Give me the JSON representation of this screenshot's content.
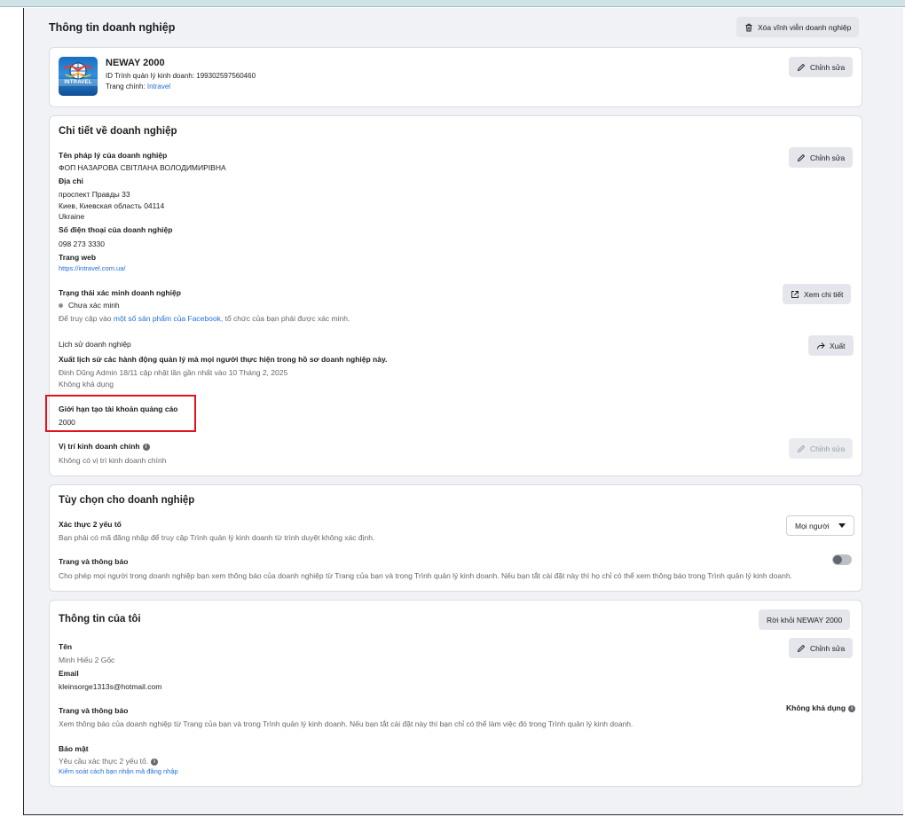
{
  "header": {
    "title": "Thông tin doanh nghiệp",
    "delete_label": "Xóa vĩnh viễn doanh nghiệp"
  },
  "business_card": {
    "logo_text": "INTRAVEL",
    "name": "NEWAY 2000",
    "id_line": "ID Trình quản lý kinh doanh: 199302597560460",
    "page_label": "Trang chính: ",
    "page_link": "Intravel",
    "edit_label": "Chỉnh sửa"
  },
  "details": {
    "title": "Chi tiết về doanh nghiệp",
    "edit_label": "Chỉnh sửa",
    "legal_name_label": "Tên pháp lý của doanh nghiệp",
    "legal_name_value": "ФОП НАЗАРОВА СВІТЛАНА ВОЛОДИМИРІВНА",
    "address_label": "Địa chỉ",
    "address_line1": "проспект Правды 33",
    "address_line2": "Киев, Киевская область 04114",
    "address_line3": "Ukraine",
    "phone_label": "Số điện thoại của doanh nghiệp",
    "phone_value": "098 273 3330",
    "website_label": "Trang web",
    "website_value": "https://intravel.com.ua/",
    "verification_label": "Trạng thái xác minh doanh nghiệp",
    "verification_status": "Chưa xác minh",
    "verification_note_prefix": "Để truy cập vào ",
    "verification_note_link": "một số sản phẩm của Facebook",
    "verification_note_suffix": ", tổ chức của bạn phải được xác minh.",
    "view_details_label": "Xem chi tiết",
    "history_label": "Lịch sử doanh nghiệp",
    "history_desc": "Xuất lịch sử các hành động quản lý mà mọi người thực hiện trong hồ sơ doanh nghiệp này.",
    "history_updated": "Đinh Dũng Admin 18/11 cập nhật lần gần nhất vào 10 Tháng 2, 2025",
    "history_unavailable": "Không khả dụng",
    "export_label": "Xuất",
    "ad_limit_label": "Giới hạn tạo tài khoản quảng cáo",
    "ad_limit_value": "2000",
    "location_label": "Vị trí kinh doanh chính",
    "location_value": "Không có vị trí kinh doanh chính",
    "location_edit_label": "Chỉnh sửa"
  },
  "options": {
    "title": "Tùy chọn cho doanh nghiệp",
    "twofa_label": "Xác thực 2 yếu tố",
    "twofa_desc": "Bạn phải có mã đăng nhập để truy cập Trình quản lý kinh doanh từ trình duyệt không xác định.",
    "twofa_selected": "Mọi người",
    "pages_notif_label": "Trang và thông báo",
    "pages_notif_desc": "Cho phép mọi người trong doanh nghiệp bạn xem thông báo của doanh nghiệp từ Trang của bạn và trong Trình quản lý kinh doanh. Nếu bạn tắt cài đặt này thì họ chỉ có thể xem thông báo trong Trình quản lý kinh doanh.",
    "pages_notif_on": false
  },
  "my_info": {
    "title": "Thông tin của tôi",
    "leave_label": "Rời khỏi NEWAY 2000",
    "edit_label": "Chỉnh sửa",
    "name_label": "Tên",
    "name_value": "Minh Hiếu 2 Gốc",
    "email_label": "Email",
    "email_value": "kleinsorge1313s@hotmail.com",
    "notif_label": "Trang và thông báo",
    "notif_desc": "Xem thông báo của doanh nghiệp từ Trang của bạn và trong Trình quản lý kinh doanh. Nếu bạn tắt cài đặt này thì bạn chỉ có thể làm việc đó trong Trình quản lý kinh doanh.",
    "notif_status": "Không khả dụng",
    "security_label": "Bảo mật",
    "security_desc": "Yêu cầu xác thực 2 yếu tố.",
    "security_link": "Kiểm soát cách bạn nhận mã đăng nhập"
  },
  "colors": {
    "accent_link": "#216fdb",
    "highlight": "#e0141e",
    "page_bg": "#f0f2f5"
  }
}
